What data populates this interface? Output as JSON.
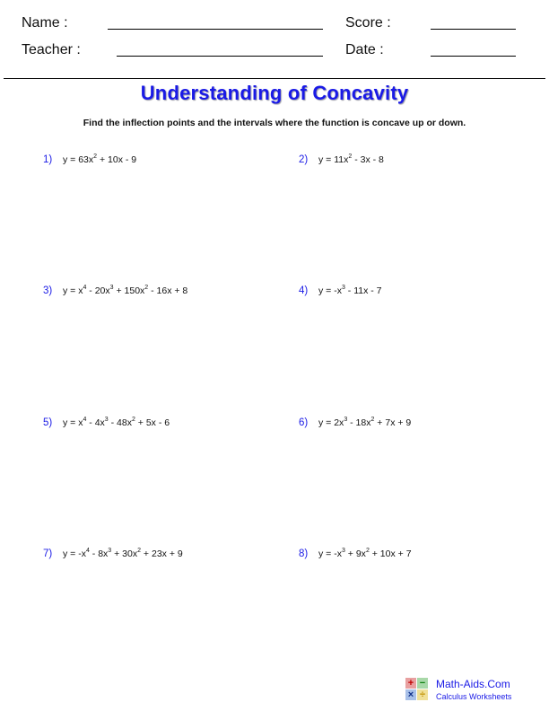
{
  "header": {
    "name_label": "Name :",
    "teacher_label": "Teacher :",
    "score_label": "Score :",
    "date_label": "Date :"
  },
  "title": "Understanding of Concavity",
  "instructions": "Find the inflection points and the intervals where the function is concave up or down.",
  "problems": [
    {
      "number": "1)",
      "terms": [
        [
          "y = 63x",
          "2"
        ],
        [
          " + 10x - 9",
          ""
        ]
      ]
    },
    {
      "number": "2)",
      "terms": [
        [
          "y = 11x",
          "2"
        ],
        [
          " - 3x - 8",
          ""
        ]
      ]
    },
    {
      "number": "3)",
      "terms": [
        [
          "y = x",
          "4"
        ],
        [
          " - 20x",
          "3"
        ],
        [
          " + 150x",
          "2"
        ],
        [
          " - 16x + 8",
          ""
        ]
      ]
    },
    {
      "number": "4)",
      "terms": [
        [
          "y = -x",
          "3"
        ],
        [
          " - 11x - 7",
          ""
        ]
      ]
    },
    {
      "number": "5)",
      "terms": [
        [
          "y = x",
          "4"
        ],
        [
          " - 4x",
          "3"
        ],
        [
          " - 48x",
          "2"
        ],
        [
          " + 5x - 6",
          ""
        ]
      ]
    },
    {
      "number": "6)",
      "terms": [
        [
          "y = 2x",
          "3"
        ],
        [
          " - 18x",
          "2"
        ],
        [
          " + 7x + 9",
          ""
        ]
      ]
    },
    {
      "number": "7)",
      "terms": [
        [
          "y = -x",
          "4"
        ],
        [
          " - 8x",
          "3"
        ],
        [
          " + 30x",
          "2"
        ],
        [
          " + 23x + 9",
          ""
        ]
      ]
    },
    {
      "number": "8)",
      "terms": [
        [
          "y = -x",
          "3"
        ],
        [
          " + 9x",
          "2"
        ],
        [
          " + 10x + 7",
          ""
        ]
      ]
    }
  ],
  "footer": {
    "logo_symbols": [
      "+",
      "−",
      "×",
      "÷"
    ],
    "brand": "Math-Aids.Com",
    "subtitle": "Calculus Worksheets"
  },
  "colors": {
    "accent_blue": "#1a1ae6"
  }
}
